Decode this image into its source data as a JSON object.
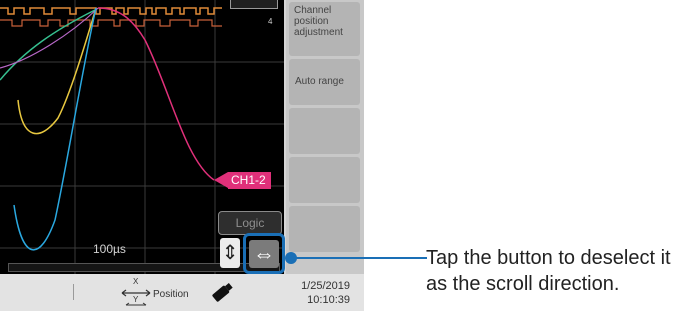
{
  "screen": {
    "time_div": "100µs",
    "channel_marker": "CH1-2",
    "channel_number": "4",
    "logic_button": "Logic",
    "vscroll_symbol": "⇕",
    "hscroll_symbol": "⇔"
  },
  "side_panel": {
    "buttons": [
      "Channel position adjustment",
      "Auto range",
      "",
      "",
      ""
    ]
  },
  "bottom_bar": {
    "position_label": "Position",
    "axis_x": "X",
    "axis_y": "Y",
    "date": "1/25/2019",
    "time": "10:10:39"
  },
  "callout": {
    "text": "Tap the button to deselect it as the scroll direction."
  },
  "colors": {
    "accent": "#1a6fb6",
    "ch1_2": "#e0307a",
    "wave_yellow": "#e8c840",
    "wave_green": "#36c090",
    "wave_cyan": "#2aa8e0",
    "logic_orange": "#e08a38"
  }
}
